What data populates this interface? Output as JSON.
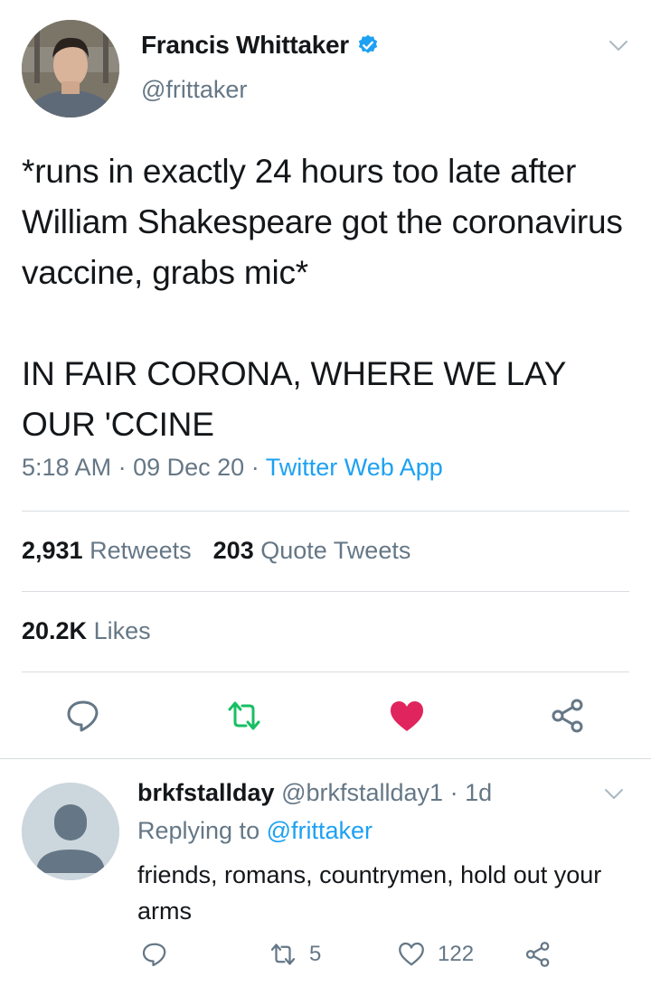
{
  "tweet": {
    "author_name": "Francis Whittaker",
    "handle": "@frittaker",
    "verified_icon": "verified-badge-icon",
    "text": "*runs in exactly 24 hours too late after William Shakespeare got the coronavirus vaccine, grabs mic*\n\nIN FAIR CORONA, WHERE WE LAY OUR 'CCINE",
    "time": "5:18 AM",
    "date": "09 Dec 20",
    "separator": "·",
    "source": "Twitter Web App",
    "stats": {
      "retweets_count": "2,931",
      "retweets_label": "Retweets",
      "quote_count": "203",
      "quote_label": "Quote Tweets",
      "likes_count": "20.2K",
      "likes_label": "Likes"
    },
    "actions": [
      "reply-icon",
      "retweet-icon",
      "like-icon",
      "share-icon"
    ]
  },
  "reply": {
    "author_name": "brkfstallday",
    "handle": "@brkfstallday1",
    "separator": "·",
    "age": "1d",
    "replying_label": "Replying to",
    "replying_to": "@frittaker",
    "text": "friends, romans, countrymen, hold out your arms",
    "retweet_count": "5",
    "like_count": "122"
  },
  "colors": {
    "accent": "#1da1f2",
    "retweet_green": "#17bf63",
    "like_red": "#e0245e",
    "muted": "#657786"
  }
}
